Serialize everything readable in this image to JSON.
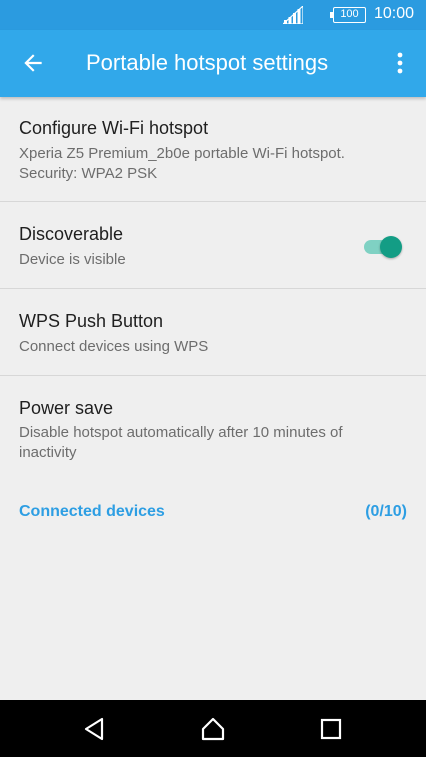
{
  "status_bar": {
    "battery": "100",
    "time": "10:00"
  },
  "app_bar": {
    "title": "Portable hotspot settings"
  },
  "items": [
    {
      "title": "Configure Wi-Fi hotspot",
      "subtitle_line1": "Xperia Z5 Premium_2b0e portable Wi-Fi hotspot.",
      "subtitle_line2": "Security: WPA2 PSK"
    },
    {
      "title": "Discoverable",
      "subtitle": "Device is visible",
      "toggle_on": true
    },
    {
      "title": "WPS Push Button",
      "subtitle": "Connect devices using WPS"
    },
    {
      "title": "Power save",
      "subtitle_line1": "Disable hotspot automatically after 10 minutes of",
      "subtitle_line2": "inactivity"
    }
  ],
  "connected": {
    "label": "Connected devices",
    "count": "(0/10)"
  },
  "colors": {
    "status_bar": "#2b9be0",
    "app_bar": "#31a8ea",
    "accent_text": "#2d9ee3",
    "toggle_thumb": "#139d85",
    "toggle_track": "#7fd1c3"
  }
}
